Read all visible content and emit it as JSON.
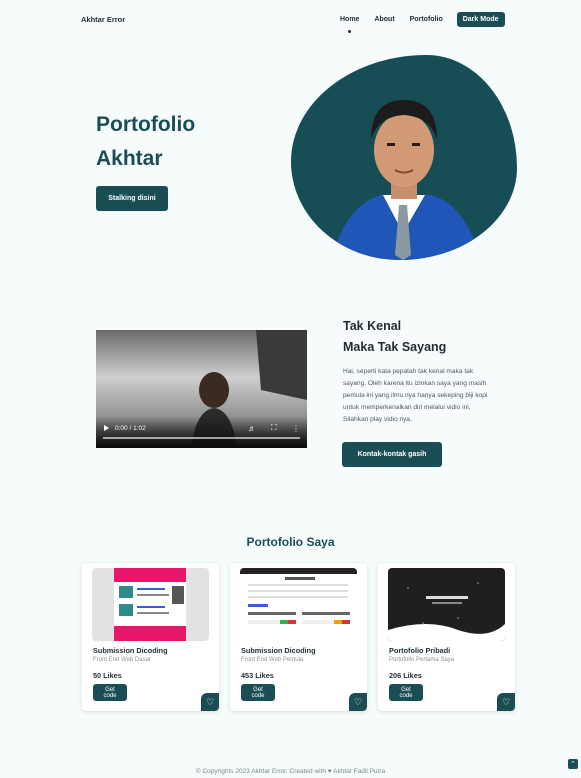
{
  "brand": "Akhtar Error",
  "nav": {
    "links": [
      "Home",
      "About",
      "Portofolio"
    ],
    "dark_mode_label": "Dark Mode"
  },
  "hero": {
    "title_line1": "Portofolio",
    "title_line2": "Akhtar",
    "button_label": "Stalking disini"
  },
  "intro": {
    "title_line1": "Tak Kenal",
    "title_line2": "Maka Tak Sayang",
    "text": "Hai, seperti kata pepatah tak kenal maka tak sayang. Oleh karena itu izinkan saya yang masih pemula ini yang ilmu nya hanya sekeping biji kopi untuk memperkenalkan diri melalui vidio ini. Silahkan play vidio nya.",
    "button_label": "Kontak-kontak gasih",
    "video_time": "0:00 / 1:02"
  },
  "portfolio": {
    "title": "Portofolio Saya",
    "cards": [
      {
        "title": "Submission Dicoding",
        "subtitle": "Front End Web Dasar",
        "likes": "50 Likes",
        "button": "Get code"
      },
      {
        "title": "Submission Dicoding",
        "subtitle": "Front End Web Pemula",
        "likes": "453 Likes",
        "button": "Get code"
      },
      {
        "title": "Portofolio Pribadi",
        "subtitle": "Portofolio Pertama Saya",
        "likes": "206 Likes",
        "button": "Get code"
      }
    ]
  },
  "footer": "© Copyrights 2023 Akhtar Error. Created with ♥ Akhtar Fadil Putra",
  "colors": {
    "accent": "#1b4d55",
    "background": "#f6fbfb"
  }
}
